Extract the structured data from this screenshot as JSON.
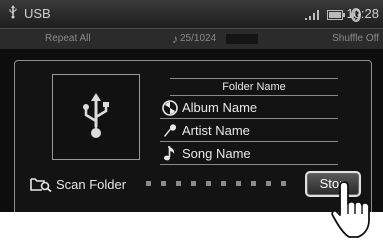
{
  "status": {
    "source": "USB",
    "time": "10:28",
    "icons": [
      "usb-icon",
      "signal-icon",
      "battery-icon",
      "bluetooth-icon"
    ]
  },
  "info_bar": {
    "repeat_label": "Repeat All",
    "track_counter": "25/1024",
    "shuffle_label": "Shuffle Off"
  },
  "track_info": {
    "folder_name": "Folder Name",
    "album_name": "Album Name",
    "artist_name": "Artist Name",
    "song_name": "Song Name"
  },
  "scan": {
    "label": "Scan Folder",
    "stop_label": "Stop",
    "progress_dots": 10
  },
  "colors": {
    "screen_bg": "#0d0d0d",
    "text": "#e8e8e8",
    "muted": "#8a8a8a"
  }
}
